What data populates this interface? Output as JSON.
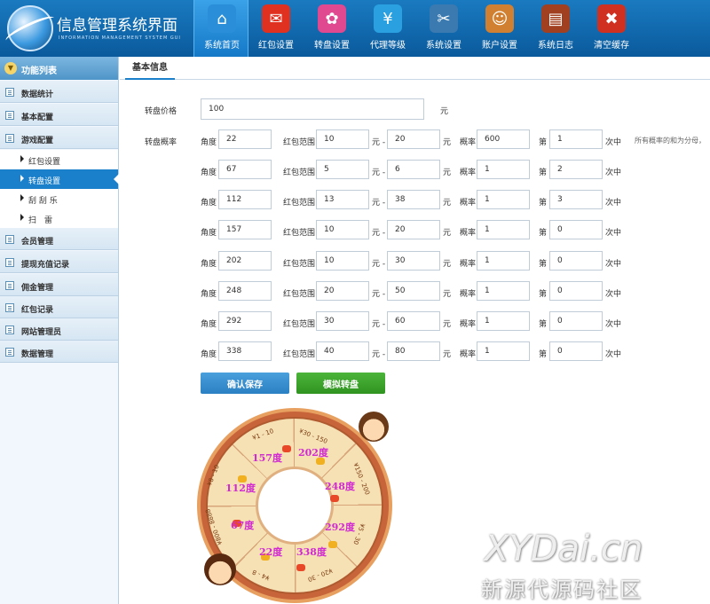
{
  "app": {
    "title": "信息管理系统界面",
    "subtitle": "INFORMATION MANAGEMENT SYSTEM GUI"
  },
  "nav": [
    {
      "label": "系统首页",
      "icon": "home-icon",
      "color": "#2a8fd8",
      "glyph": "⌂"
    },
    {
      "label": "红包设置",
      "icon": "red-envelope-icon",
      "color": "#e03020",
      "glyph": "✉"
    },
    {
      "label": "转盘设置",
      "icon": "wheel-icon",
      "color": "#e04890",
      "glyph": "✿"
    },
    {
      "label": "代理等级",
      "icon": "yen-cloud-icon",
      "color": "#2aa0e0",
      "glyph": "¥"
    },
    {
      "label": "系统设置",
      "icon": "tools-icon",
      "color": "#3a7ab0",
      "glyph": "✂"
    },
    {
      "label": "账户设置",
      "icon": "user-icon",
      "color": "#d08030",
      "glyph": "☺"
    },
    {
      "label": "系统日志",
      "icon": "log-book-icon",
      "color": "#a04020",
      "glyph": "▤"
    },
    {
      "label": "清空缓存",
      "icon": "clear-cache-icon",
      "color": "#d03020",
      "glyph": "✖"
    }
  ],
  "sidebar": {
    "header": "功能列表",
    "items": [
      {
        "label": "数据统计"
      },
      {
        "label": "基本配置"
      },
      {
        "label": "游戏配置"
      },
      {
        "label": "会员管理"
      },
      {
        "label": "提现充值记录"
      },
      {
        "label": "佣金管理"
      },
      {
        "label": "红包记录"
      },
      {
        "label": "网站管理员"
      },
      {
        "label": "数据管理"
      }
    ],
    "sub_items": [
      {
        "label": "红包设置"
      },
      {
        "label": "转盘设置"
      },
      {
        "label": "刮 刮 乐"
      },
      {
        "label": "扫　雷"
      }
    ]
  },
  "main": {
    "tab": "基本信息",
    "price_label": "转盘价格",
    "price_value": "100",
    "price_unit": "元",
    "prob_label": "转盘概率",
    "labels": {
      "angle": "角度",
      "range": "红包范围",
      "yuan_dash": "元 -",
      "yuan": "元",
      "prob": "概率",
      "nth": "第",
      "hit": "次中"
    },
    "note": "所有概率的和为分母，",
    "rows": [
      {
        "angle": "22",
        "min": "10",
        "max": "20",
        "prob": "600",
        "nth": "1"
      },
      {
        "angle": "67",
        "min": "5",
        "max": "6",
        "prob": "1",
        "nth": "2"
      },
      {
        "angle": "112",
        "min": "13",
        "max": "38",
        "prob": "1",
        "nth": "3"
      },
      {
        "angle": "157",
        "min": "10",
        "max": "20",
        "prob": "1",
        "nth": "0"
      },
      {
        "angle": "202",
        "min": "10",
        "max": "30",
        "prob": "1",
        "nth": "0"
      },
      {
        "angle": "248",
        "min": "20",
        "max": "50",
        "prob": "1",
        "nth": "0"
      },
      {
        "angle": "292",
        "min": "30",
        "max": "60",
        "prob": "1",
        "nth": "0"
      },
      {
        "angle": "338",
        "min": "40",
        "max": "80",
        "prob": "1",
        "nth": "0"
      }
    ],
    "save_label": "确认保存",
    "simulate_label": "模拟转盘"
  },
  "wheel": {
    "angle_labels": [
      "157度",
      "202度",
      "112度",
      "248度",
      "67度",
      "292度",
      "22度",
      "338度"
    ],
    "rim_texts": [
      "¥1 - 10",
      "¥30 - 150",
      "¥150 - 200",
      "¥5 - 30",
      "¥20 - 30",
      "¥4 - 8",
      "¥800 - 8888",
      "¥8 - 10"
    ]
  },
  "watermark": {
    "line1": "XYDai.cn",
    "line2": "新源代源码社区"
  }
}
